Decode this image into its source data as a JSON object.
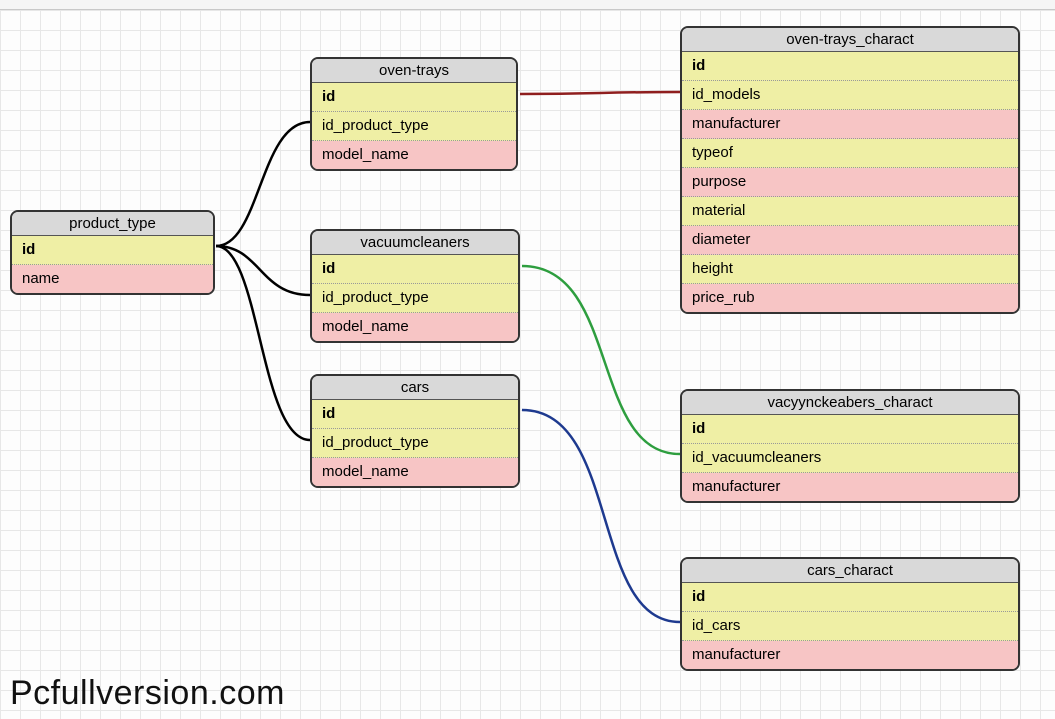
{
  "watermark": "Pcfullversion.com",
  "tables": {
    "product_type": {
      "title": "product_type",
      "cols": [
        "id",
        "name"
      ]
    },
    "oven_trays": {
      "title": "oven-trays",
      "cols": [
        "id",
        "id_product_type",
        "model_name"
      ]
    },
    "vacuumcleaners": {
      "title": "vacuumcleaners",
      "cols": [
        "id",
        "id_product_type",
        "model_name"
      ]
    },
    "cars": {
      "title": "cars",
      "cols": [
        "id",
        "id_product_type",
        "model_name"
      ]
    },
    "oven_trays_charact": {
      "title": "oven-trays_charact",
      "cols": [
        "id",
        "id_models",
        "manufacturer",
        "typeof",
        "purpose",
        "material",
        "diameter",
        "height",
        "price_rub"
      ]
    },
    "vacyynckeabers_charact": {
      "title": "vacyynckeabers_charact",
      "cols": [
        "id",
        "id_vacuumcleaners",
        "manufacturer"
      ]
    },
    "cars_charact": {
      "title": "cars_charact",
      "cols": [
        "id",
        "id_cars",
        "manufacturer"
      ]
    }
  },
  "connectors": {
    "color_product": "#000000",
    "color_oven": "#8f1e1e",
    "color_vacuum": "#2e9e3f",
    "color_cars": "#1e3a8f"
  }
}
